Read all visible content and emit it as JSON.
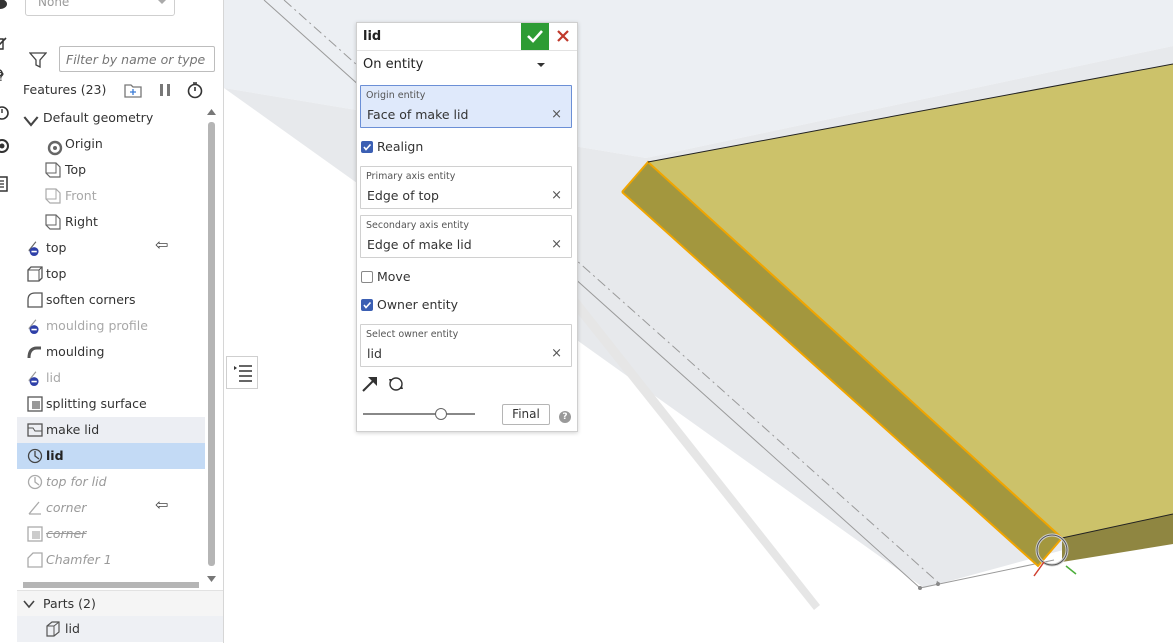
{
  "top_dropdown": {
    "value": "None"
  },
  "filter": {
    "placeholder": "Filter by name or type"
  },
  "features": {
    "header": "Features (23)"
  },
  "tree": {
    "group_label": "Default geometry",
    "items": [
      {
        "label": "Origin"
      },
      {
        "label": "Top"
      },
      {
        "label": "Front"
      },
      {
        "label": "Right"
      },
      {
        "label": "top"
      },
      {
        "label": "top"
      },
      {
        "label": "soften corners"
      },
      {
        "label": "moulding profile"
      },
      {
        "label": "moulding"
      },
      {
        "label": "lid"
      },
      {
        "label": "splitting surface"
      },
      {
        "label": "make lid"
      },
      {
        "label": "lid"
      },
      {
        "label": "top for lid"
      },
      {
        "label": "corner"
      },
      {
        "label": "corner"
      },
      {
        "label": "Chamfer 1"
      }
    ],
    "arrow_mark": "⇦"
  },
  "parts": {
    "header": "Parts (2)",
    "items": [
      {
        "label": "lid"
      }
    ]
  },
  "dialog": {
    "title": "lid",
    "type_value": "On entity",
    "origin": {
      "label": "Origin entity",
      "value": "Face of make lid"
    },
    "realign_label": "Realign",
    "primary": {
      "label": "Primary axis entity",
      "value": "Edge of top"
    },
    "secondary": {
      "label": "Secondary axis entity",
      "value": "Edge of make lid"
    },
    "move_label": "Move",
    "owner_label": "Owner entity",
    "owner_select": {
      "label": "Select owner entity",
      "value": "lid"
    },
    "clear_glyph": "×",
    "final_label": "Final",
    "help_glyph": "?",
    "realign_checked": true,
    "move_checked": false,
    "owner_checked": true,
    "slider_fraction": 0.7
  },
  "colors": {
    "accent_green": "#2e9c34",
    "close_red": "#c0392b",
    "selection_blue": "#c3daf5",
    "part_face": "#ccc26a",
    "part_edge_highlight": "#f0a500",
    "checkbox_blue": "#3b5fb3"
  }
}
